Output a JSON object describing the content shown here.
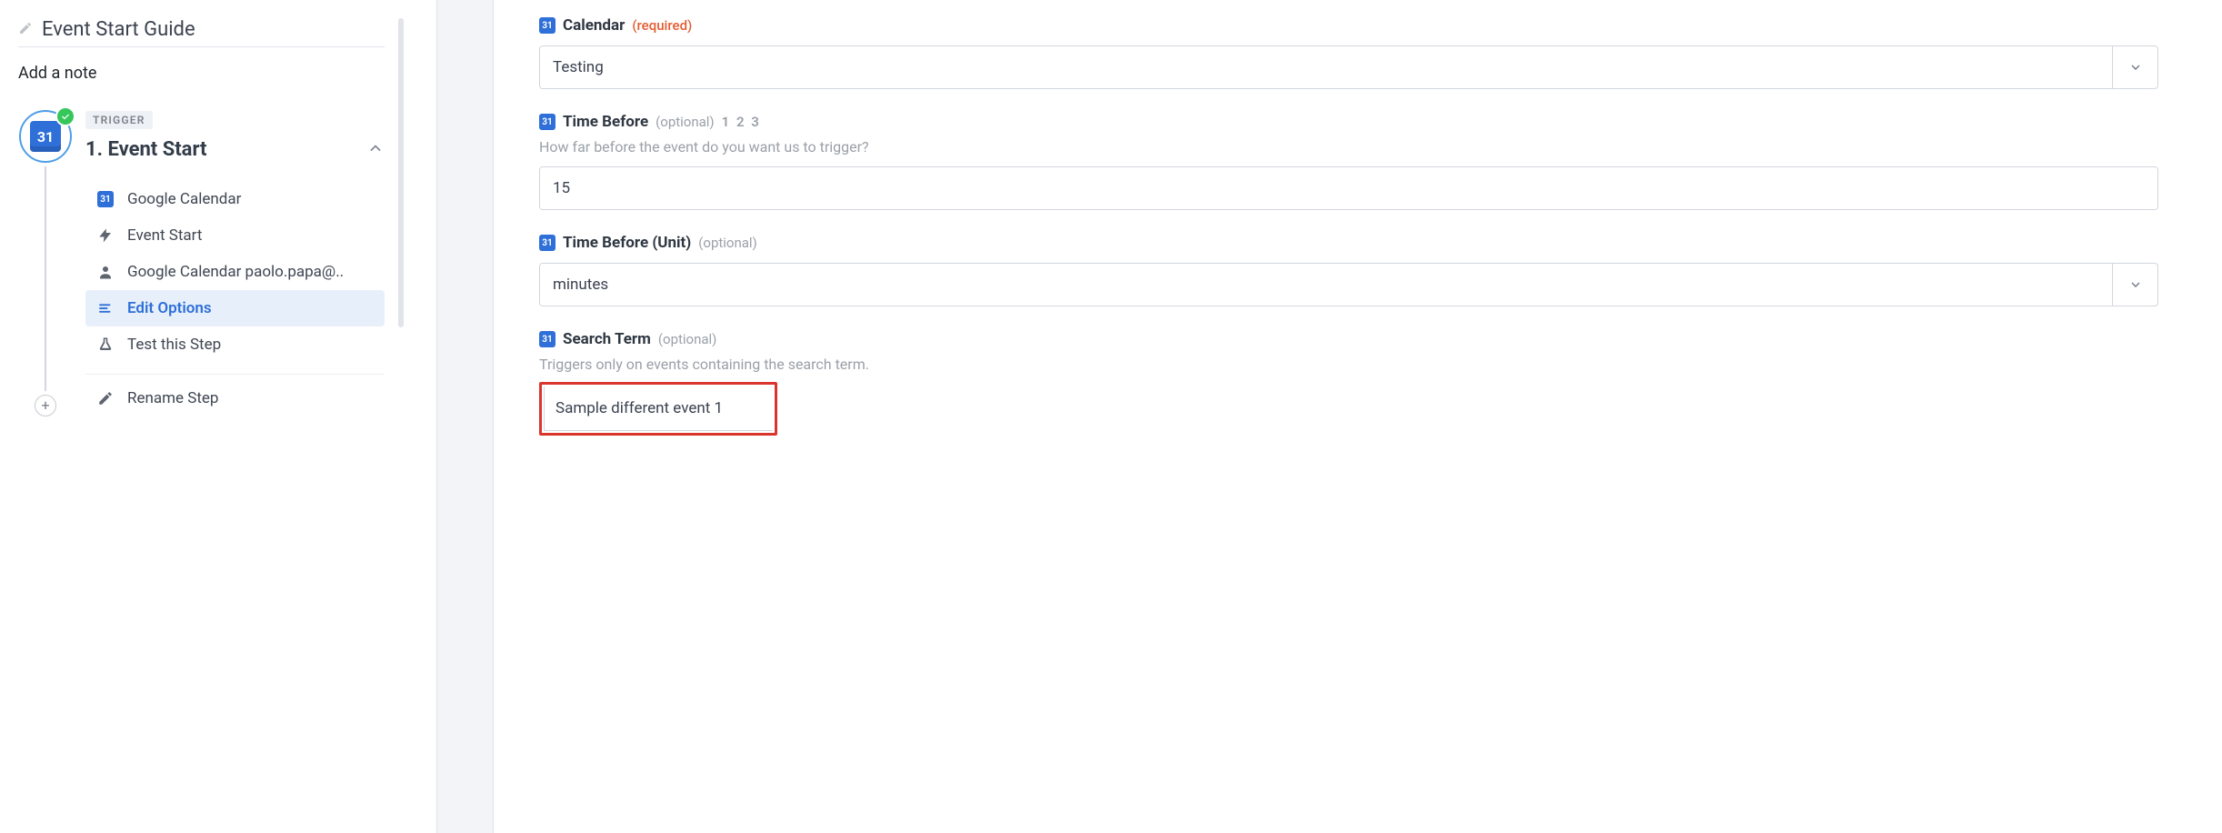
{
  "left": {
    "title": "Event Start Guide",
    "add_note": "Add a note",
    "trigger_tag": "TRIGGER",
    "step_title": "1. Event Start",
    "badge_num": "31",
    "substeps": {
      "app": "Google Calendar",
      "trigger": "Event Start",
      "account": "Google Calendar paolo.papa@..",
      "edit_options": "Edit Options",
      "test": "Test this Step",
      "rename": "Rename Step"
    }
  },
  "form": {
    "badge_num": "31",
    "required_label": "(required)",
    "optional_label": "(optional)",
    "num_hint": "1 2 3",
    "calendar": {
      "label": "Calendar",
      "value": "Testing"
    },
    "time_before": {
      "label": "Time Before",
      "help": "How far before the event do you want us to trigger?",
      "value": "15"
    },
    "time_before_unit": {
      "label": "Time Before (Unit)",
      "value": "minutes"
    },
    "search_term": {
      "label": "Search Term",
      "help": "Triggers only on events containing the search term.",
      "value": "Sample different event 1"
    }
  }
}
